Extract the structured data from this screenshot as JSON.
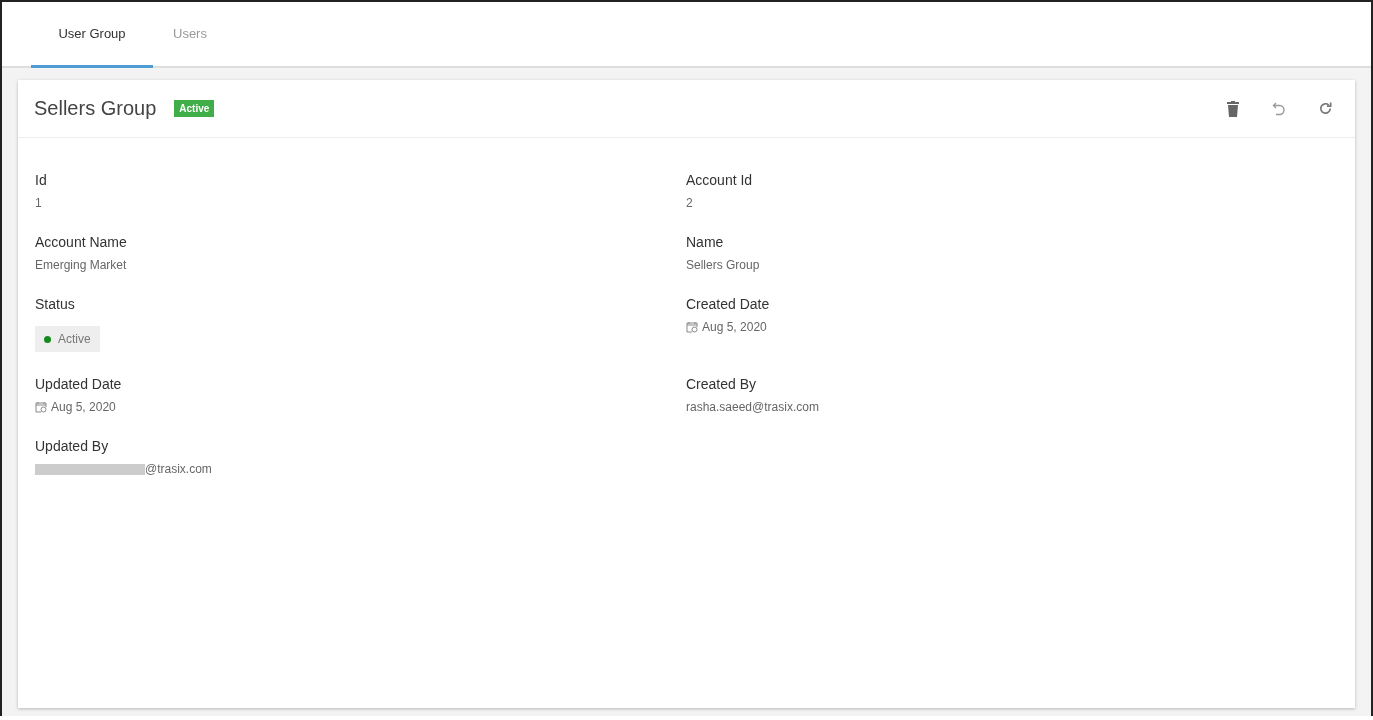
{
  "tabs": [
    {
      "label": "User Group",
      "selected": true
    },
    {
      "label": "Users",
      "selected": false
    }
  ],
  "header": {
    "title": "Sellers Group",
    "badge": "Active",
    "actions": [
      {
        "kind": "delete"
      },
      {
        "kind": "undo"
      },
      {
        "kind": "refresh"
      }
    ]
  },
  "fields": [
    {
      "label": "Id",
      "kind": "text",
      "value": "1"
    },
    {
      "label": "Account Id",
      "kind": "text",
      "value": "2"
    },
    {
      "label": "Account Name",
      "kind": "text",
      "value": "Emerging Market"
    },
    {
      "label": "Name",
      "kind": "text",
      "value": "Sellers Group"
    },
    {
      "label": "Status",
      "kind": "status",
      "value": "Active",
      "color": "#138a1c"
    },
    {
      "label": "Created Date",
      "kind": "date",
      "value": "Aug 5, 2020"
    },
    {
      "label": "Updated Date",
      "kind": "date",
      "value": "Aug 5, 2020"
    },
    {
      "label": "Created By",
      "kind": "text",
      "value": "rasha.saeed@trasix.com"
    },
    {
      "label": "Updated By",
      "kind": "redacted",
      "value": "@trasix.com"
    }
  ]
}
